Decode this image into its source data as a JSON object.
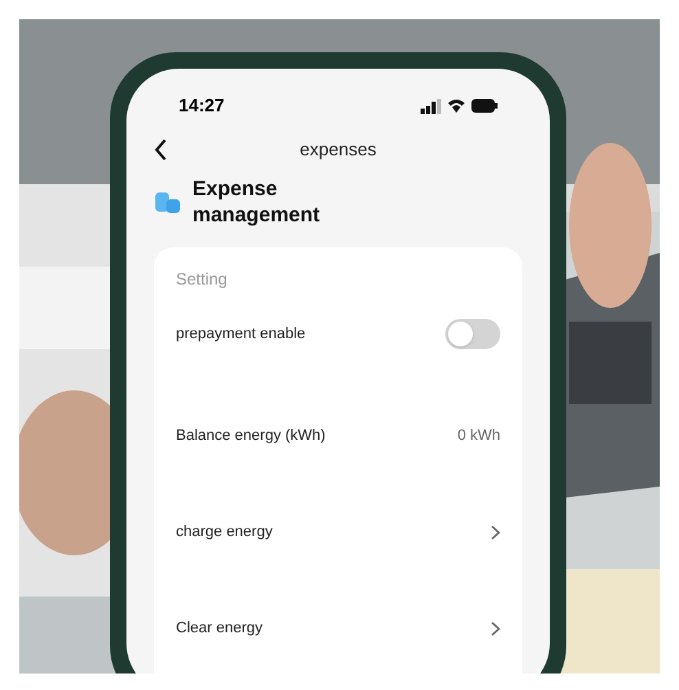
{
  "status_bar": {
    "time": "14:27"
  },
  "nav": {
    "title": "expenses"
  },
  "header": {
    "title": "Expense management"
  },
  "settings": {
    "section_label": "Setting",
    "rows": [
      {
        "kind": "toggle",
        "label": "prepayment enable",
        "on": false
      },
      {
        "kind": "value",
        "label": "Balance energy (kWh)",
        "value": "0 kWh"
      },
      {
        "kind": "link",
        "label": "charge energy"
      },
      {
        "kind": "link",
        "label": "Clear energy"
      }
    ]
  }
}
